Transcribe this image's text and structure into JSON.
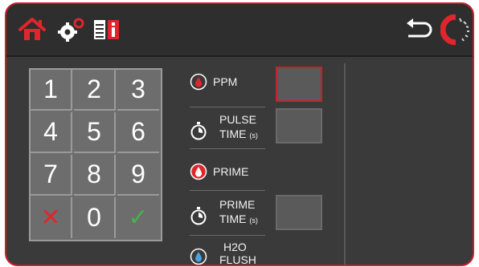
{
  "colors": {
    "accent": "#c7202a",
    "background": "#3a3a3a",
    "check": "#4caf50",
    "cancel": "#e0262c"
  },
  "topbar": {
    "icons": [
      "home-icon",
      "settings-gears-icon",
      "info-icon",
      "back-arrow-icon",
      "loading-ring-icon"
    ]
  },
  "keypad": {
    "keys": [
      "1",
      "2",
      "3",
      "4",
      "5",
      "6",
      "7",
      "8",
      "9",
      "✕",
      "0",
      "✓"
    ]
  },
  "params": {
    "ppm": {
      "label": "PPM"
    },
    "pulse_time": {
      "line1": "PULSE",
      "line2": "TIME",
      "unit": "(s)"
    },
    "prime": {
      "label": "PRIME"
    },
    "prime_time": {
      "line1": "PRIME",
      "line2": "TIME",
      "unit": "(s)"
    },
    "h2o_flush": {
      "line1": "H2O",
      "line2": "FLUSH"
    }
  }
}
